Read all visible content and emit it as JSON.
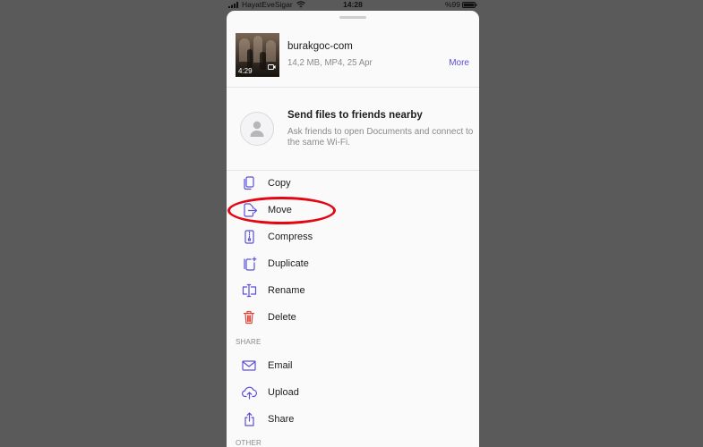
{
  "status_bar": {
    "carrier": "HayatEveSigar",
    "time": "14:28",
    "battery_text": "%99",
    "battery_level": 0.99
  },
  "file": {
    "name": "burakgoc-com",
    "details": "14,2 MB, MP4, 25 Apr",
    "duration": "4:29",
    "more_label": "More"
  },
  "nearby": {
    "title": "Send files to friends nearby",
    "description": "Ask friends to open Documents and connect to the same Wi-Fi."
  },
  "actions": [
    {
      "label": "Copy",
      "icon": "copy-icon"
    },
    {
      "label": "Move",
      "icon": "move-icon"
    },
    {
      "label": "Compress",
      "icon": "compress-icon"
    },
    {
      "label": "Duplicate",
      "icon": "duplicate-icon"
    },
    {
      "label": "Rename",
      "icon": "rename-icon"
    },
    {
      "label": "Delete",
      "icon": "trash-icon",
      "destructive": true
    }
  ],
  "share_section": {
    "header": "SHARE",
    "items": [
      {
        "label": "Email",
        "icon": "envelope-icon"
      },
      {
        "label": "Upload",
        "icon": "cloud-upload-icon"
      },
      {
        "label": "Share",
        "icon": "share-icon"
      }
    ]
  },
  "other_section": {
    "header": "OTHER"
  },
  "colors": {
    "backdrop": "#5a5a5a",
    "sheet": "#fafafa",
    "accent": "#5b4fd4",
    "destructive": "#e0473c",
    "annotation": "#e30613"
  }
}
